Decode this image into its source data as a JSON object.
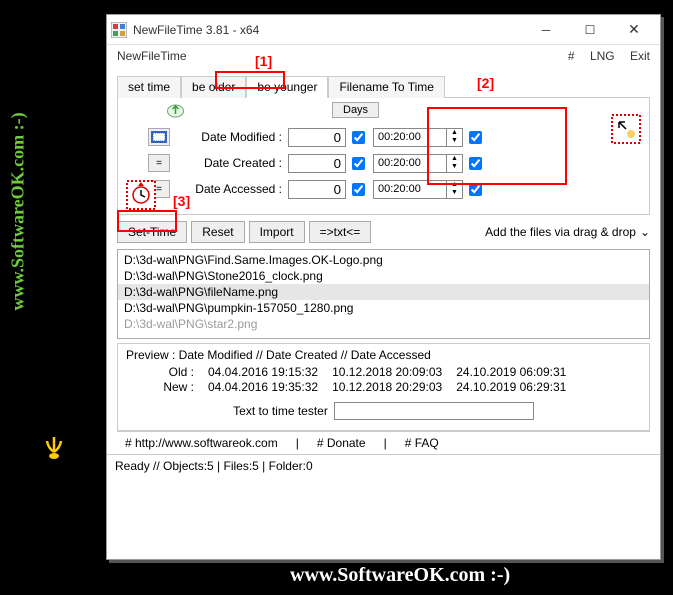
{
  "watermark": {
    "left": "www.SoftwareOK.com :-)",
    "bottom": "www.SoftwareOK.com :-)"
  },
  "window": {
    "title": "NewFileTime 3.81 - x64",
    "menuLeft": "NewFileTime",
    "menuRight": {
      "hash": "#",
      "lng": "LNG",
      "exit": "Exit"
    }
  },
  "tabs": [
    "set time",
    "be older",
    "be younger",
    "Filename To Time"
  ],
  "panel": {
    "daysLabel": "Days",
    "rows": [
      {
        "label": "Date Modified :",
        "days": "0",
        "time": "00:20:00",
        "cb1": true,
        "cb2": true
      },
      {
        "label": "Date Created :",
        "days": "0",
        "time": "00:20:00",
        "cb1": true,
        "cb2": true
      },
      {
        "label": "Date Accessed :",
        "days": "0",
        "time": "00:20:00",
        "cb1": true,
        "cb2": true
      }
    ],
    "eq": "="
  },
  "buttons": {
    "setTime": "Set-Time",
    "reset": "Reset",
    "import": "Import",
    "txt": "=>txt<=",
    "drag": "Add the files via drag & drop"
  },
  "files": [
    "D:\\3d-wal\\PNG\\Find.Same.Images.OK-Logo.png",
    "D:\\3d-wal\\PNG\\Stone2016_clock.png",
    "D:\\3d-wal\\PNG\\fileName.png",
    "D:\\3d-wal\\PNG\\pumpkin-157050_1280.png",
    "D:\\3d-wal\\PNG\\star2.png"
  ],
  "preview": {
    "header": "Preview :   Date Modified    //    Date Created    //    Date Accessed",
    "oldLabel": "Old :",
    "newLabel": "New :",
    "old": [
      "04.04.2016 19:15:32",
      "10.12.2018 20:09:03",
      "24.10.2019 06:09:31"
    ],
    "new": [
      "04.04.2016 19:35:32",
      "10.12.2018 20:29:03",
      "24.10.2019 06:29:31"
    ]
  },
  "tester": {
    "label": "Text to time tester",
    "value": ""
  },
  "links": {
    "url": "# http://www.softwareok.com",
    "donate": "# Donate",
    "faq": "# FAQ"
  },
  "status": "Ready // Objects:5 | Files:5 | Folder:0",
  "annotations": {
    "a1": "[1]",
    "a2": "[2]",
    "a3": "[3]"
  }
}
